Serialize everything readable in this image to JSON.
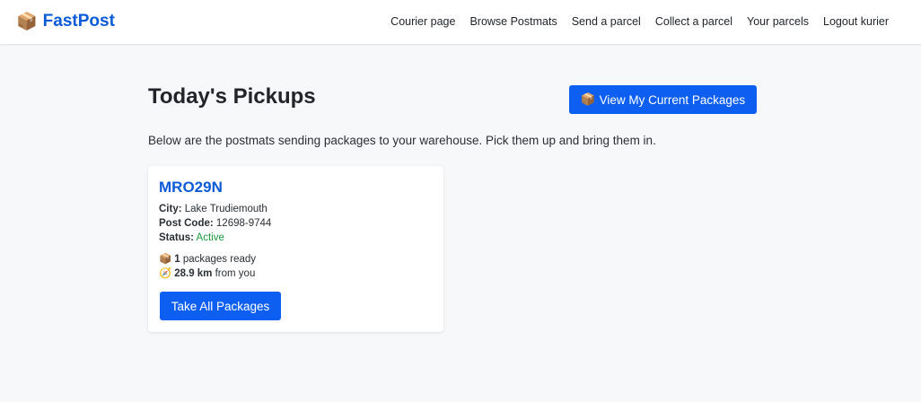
{
  "brand": {
    "name": "FastPost",
    "icon": "package-icon"
  },
  "nav": {
    "items": [
      {
        "label": "Courier page"
      },
      {
        "label": "Browse Postmats"
      },
      {
        "label": "Send a parcel"
      },
      {
        "label": "Collect a parcel"
      },
      {
        "label": "Your parcels"
      },
      {
        "label": "Logout kurier"
      }
    ]
  },
  "main": {
    "title": "Today's Pickups",
    "view_button_label": "View My Current Packages",
    "intro": "Below are the postmats sending packages to your warehouse. Pick them up and bring them in."
  },
  "postmat": {
    "code": "MRO29N",
    "city_label": "City:",
    "city": "Lake Trudiemouth",
    "post_code_label": "Post Code:",
    "post_code": "12698-9744",
    "status_label": "Status:",
    "status": "Active",
    "status_color": "#1a9a3c",
    "packages_count": "1",
    "packages_text": "packages ready",
    "distance": "28.9 km",
    "distance_text": "from you",
    "take_button_label": "Take All Packages"
  },
  "colors": {
    "accent": "#0d5ff2",
    "brand": "#0b5ad8"
  }
}
